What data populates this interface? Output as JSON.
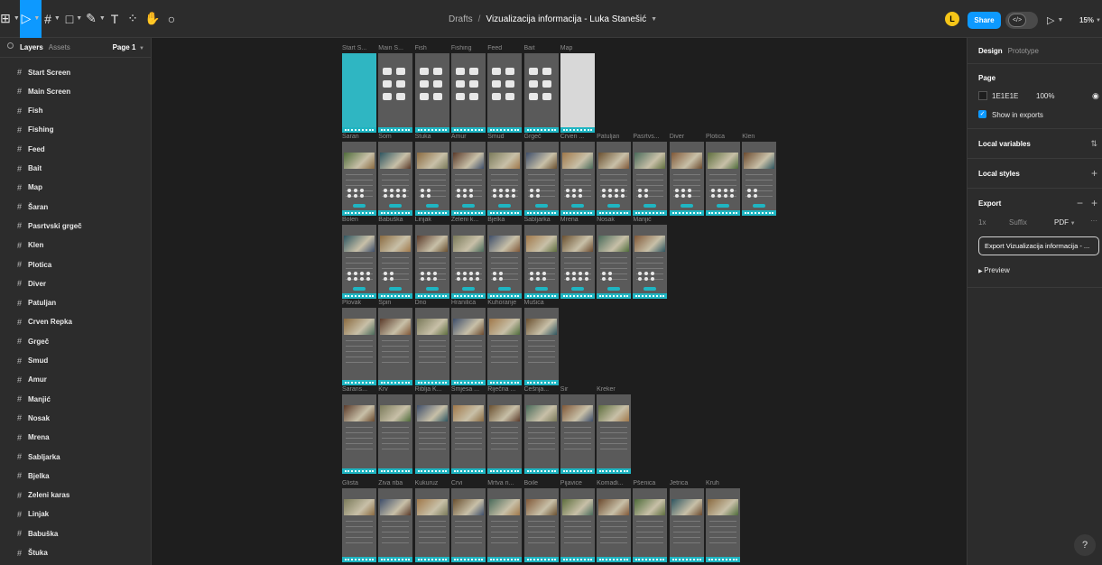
{
  "toolbar": {
    "tools": [
      {
        "name": "main-menu-tool",
        "glyph": "⊞",
        "active": false
      },
      {
        "name": "move-tool",
        "glyph": "▷",
        "active": true
      },
      {
        "name": "frame-tool",
        "glyph": "#",
        "active": false
      },
      {
        "name": "rectangle-tool",
        "glyph": "□",
        "active": false
      },
      {
        "name": "pen-tool",
        "glyph": "✎",
        "active": false
      },
      {
        "name": "text-tool",
        "glyph": "T",
        "active": false
      },
      {
        "name": "resources-tool",
        "glyph": "⁘",
        "active": false
      },
      {
        "name": "hand-tool",
        "glyph": "✋",
        "active": false
      },
      {
        "name": "comment-tool",
        "glyph": "○",
        "active": false
      }
    ],
    "breadcrumb_folder": "Drafts",
    "breadcrumb_separator": "/",
    "file_name": "Vizualizacija informacija - Luka Stanešić",
    "avatar_initial": "L",
    "share_label": "Share",
    "dev_mode_glyph": "</>",
    "present_glyph": "▷",
    "zoom_label": "15%"
  },
  "left_panel": {
    "tab_layers": "Layers",
    "tab_assets": "Assets",
    "page_label": "Page 1",
    "layers": [
      "Start Screen",
      "Main Screen",
      "Fish",
      "Fishing",
      "Feed",
      "Bait",
      "Map",
      "Šaran",
      "Pasrtvski grgeč",
      "Klen",
      "Plotica",
      "Diver",
      "Patuljan",
      "Crven Repka",
      "Grgeč",
      "Smud",
      "Amur",
      "Manjić",
      "Nosak",
      "Mrena",
      "Sabljarka",
      "Bjelka",
      "Zeleni karas",
      "Linjak",
      "Babuška",
      "Štuka"
    ]
  },
  "canvas": {
    "rows": [
      {
        "labels": [
          "Start S...",
          "Main S...",
          "Fish",
          "Fishing",
          "Feed",
          "Bait",
          "Map"
        ]
      },
      {
        "labels": [
          "Šaran",
          "Som",
          "Štuka",
          "Amur",
          "Smud",
          "Grgeč",
          "Crven ...",
          "Patuljan",
          "Pasrtvs...",
          "Diver",
          "Plotica",
          "Klen"
        ]
      },
      {
        "labels": [
          "Bolen",
          "Babuška",
          "Linjak",
          "Zeleni k...",
          "Bjelka",
          "Sabljarka",
          "Mrena",
          "Nosak",
          "Manjić"
        ]
      },
      {
        "labels": [
          "Plovak",
          "Spin",
          "Dno",
          "Hranilica",
          "Kuhoranje",
          "Mušica"
        ]
      },
      {
        "labels": [
          "Šarans...",
          "Krv",
          "Riblja K...",
          "Smjesa ...",
          "Riječna ...",
          "Češnja...",
          "Sir",
          "Kreker"
        ]
      },
      {
        "labels": [
          "Glista",
          "Živa riba",
          "Kukuruz",
          "Crvi",
          "Mrtva ri...",
          "Boile",
          "Pijavice",
          "Komadi...",
          "Pšenica",
          "Jetrica",
          "Kruh"
        ]
      }
    ]
  },
  "right_panel": {
    "tab_design": "Design",
    "tab_prototype": "Prototype",
    "page_heading": "Page",
    "page_color": "1E1E1E",
    "page_opacity": "100%",
    "show_in_exports": "Show in exports",
    "local_variables": "Local variables",
    "local_styles": "Local styles",
    "export_heading": "Export",
    "export_scale": "1x",
    "export_suffix": "Suffix",
    "export_format": "PDF",
    "export_button": "Export Vizualizacija informacija - ...",
    "preview_label": "Preview"
  },
  "help_label": "?",
  "colors": {
    "accent": "#0d99ff",
    "canvas": "#1e1e1e",
    "panel": "#2c2c2c",
    "frame_teal": "#1fb5c2"
  }
}
